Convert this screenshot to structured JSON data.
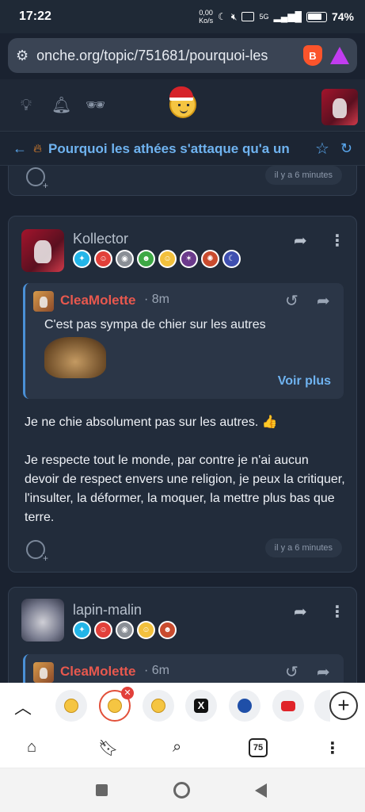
{
  "status_bar": {
    "time": "17:22",
    "net_speed": "0,00",
    "net_unit": "Ko/s",
    "network": "5G",
    "battery": "74%"
  },
  "browser": {
    "url": "onche.org/topic/751681/pourquoi-les"
  },
  "topic": {
    "title": "Pourquoi les athées s'attaque qu'a un"
  },
  "posts": [
    {
      "time": "il y a 6 minutes"
    },
    {
      "username": "Kollector",
      "quote": {
        "author": "CleaMolette",
        "age": "8m",
        "text": "C'est pas sympa de chier sur les autres",
        "more": "Voir plus"
      },
      "body_line1": "Je ne chie absolument pas sur les autres. 👍",
      "body_para2": "Je respecte tout le monde, par contre je n'ai aucun devoir de respect envers une religion, je peux la critiquer, l'insulter, la déformer, la moquer, la mettre plus bas que terre.",
      "time": "il y a 6 minutes"
    },
    {
      "username": "lapin-malin",
      "quote": {
        "author": "CleaMolette",
        "age": "6m"
      }
    }
  ],
  "tab_count": "75",
  "colors": {
    "link": "#6fb3f0",
    "quote_author": "#e8584e",
    "background": "#1a2230",
    "card": "#222c3b"
  }
}
